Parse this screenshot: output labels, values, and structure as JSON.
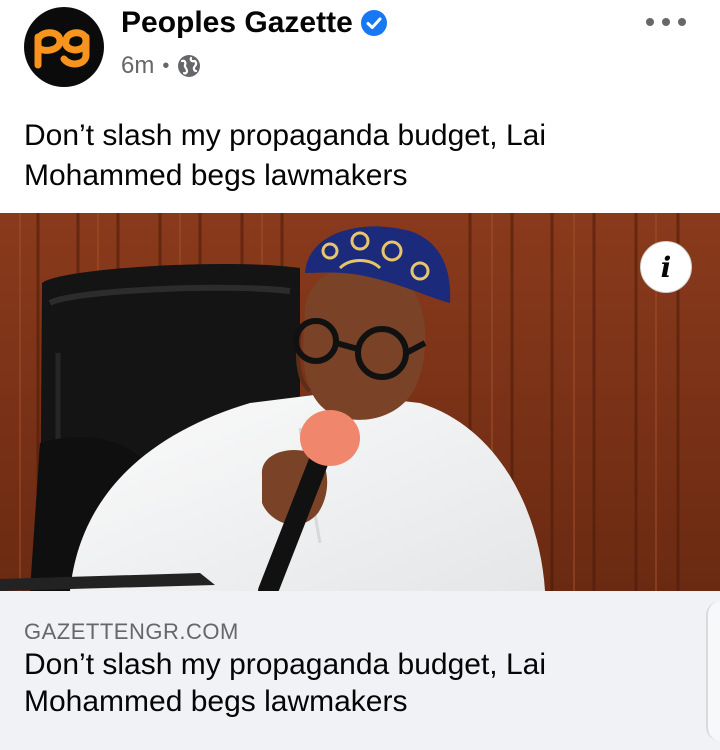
{
  "post": {
    "page_name": "Peoples Gazette",
    "avatar_text": "pg",
    "timestamp": "6m",
    "separator": "•",
    "text": "Don’t slash my propaganda budget, Lai Mohammed begs lawmakers"
  },
  "photo": {
    "info_label": "i"
  },
  "link_preview": {
    "domain": "GAZETTENGR.COM",
    "title": "Don’t slash my propaganda budget, Lai Mohammed begs lawmakers"
  },
  "icons": {
    "verified": "verified-badge-icon",
    "audience": "globe-icon",
    "more": "more-options-icon",
    "info": "info-icon"
  },
  "colors": {
    "verified_blue": "#1877f2",
    "brand_orange": "#f7941d",
    "secondary_text": "#65676b",
    "preview_bg": "#f0f2f5"
  }
}
